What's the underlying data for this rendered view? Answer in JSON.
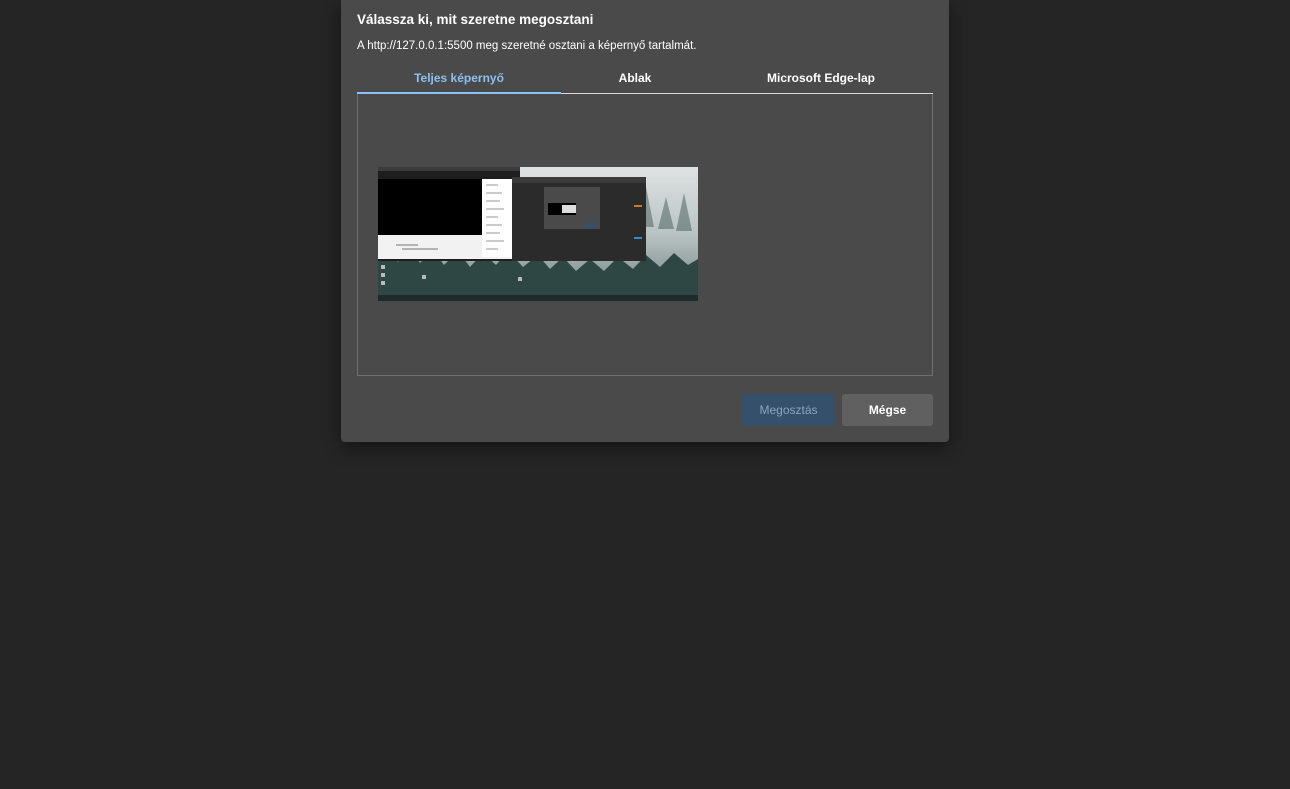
{
  "dialog": {
    "title": "Válassza ki, mit szeretne megosztani",
    "subtitle": "A http://127.0.0.1:5500 meg szeretné osztani a képernyő tartalmát."
  },
  "tabs": [
    {
      "label": "Teljes képernyő",
      "active": true
    },
    {
      "label": "Ablak",
      "active": false
    },
    {
      "label": "Microsoft Edge-lap",
      "active": false
    }
  ],
  "buttons": {
    "share": "Megosztás",
    "cancel": "Mégse"
  },
  "colors": {
    "dialog_bg": "#4a4a4a",
    "page_bg": "#252525",
    "accent": "#8cc0f2",
    "share_bg_disabled": "#34506b",
    "cancel_bg": "#606060"
  }
}
